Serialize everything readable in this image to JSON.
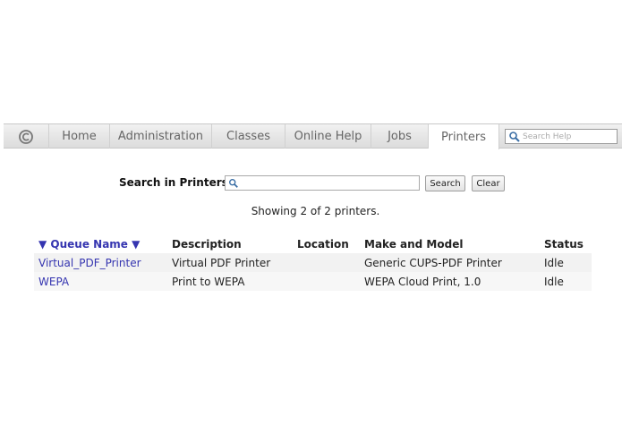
{
  "nav": {
    "tabs": [
      {
        "label": "Home"
      },
      {
        "label": "Administration"
      },
      {
        "label": "Classes"
      },
      {
        "label": "Online Help"
      },
      {
        "label": "Jobs"
      },
      {
        "label": "Printers"
      }
    ],
    "active_tab": "Printers",
    "search_placeholder": "Search Help",
    "logo_icon": "cups-logo-icon"
  },
  "search": {
    "label": "Search in Printers:",
    "value": "",
    "search_button": "Search",
    "clear_button": "Clear"
  },
  "status": {
    "showing": "Showing 2 of 2 printers."
  },
  "table": {
    "headers": {
      "queue_name": "▼ Queue Name ▼",
      "description": "Description",
      "location": "Location",
      "make_model": "Make and Model",
      "status": "Status"
    },
    "rows": [
      {
        "queue_name": "Virtual_PDF_Printer",
        "description": "Virtual PDF Printer",
        "location": "",
        "make_model": "Generic CUPS-PDF Printer",
        "status": "Idle"
      },
      {
        "queue_name": "WEPA",
        "description": "Print to WEPA",
        "location": "",
        "make_model": "WEPA Cloud Print, 1.0",
        "status": "Idle"
      }
    ]
  },
  "colors": {
    "link": "#3535b0",
    "nav_bg": "#e4e4e4"
  }
}
